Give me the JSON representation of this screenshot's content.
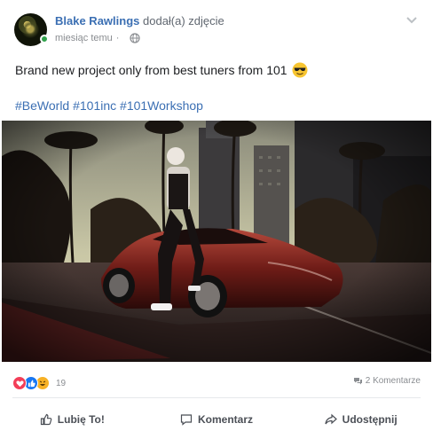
{
  "post": {
    "author_name": "Blake Rawlings",
    "author_action": "dodał(a) zdjęcie",
    "timestamp": "miesiąc temu",
    "separator": "·",
    "privacy_icon": "globe-icon",
    "menu_icon": "chevron-down-icon",
    "text": "Brand new project only from best tuners from 101",
    "text_emoji": "sunglasses-emoji-icon",
    "hashtags": "#BeWorld #101inc #101Workshop",
    "photo_icon": "photo-image"
  },
  "stats": {
    "reaction_icons": [
      "love-reaction-icon",
      "like-reaction-icon",
      "haha-reaction-icon"
    ],
    "reaction_count": "19",
    "comments_label": "2 Komentarze"
  },
  "actions": {
    "like_label": "Lubię To!",
    "comment_label": "Komentarz",
    "share_label": "Udostępnij"
  },
  "colors": {
    "link": "#3b6fb3",
    "online": "#31a24c",
    "love": "#f33e58",
    "like": "#1877f2",
    "haha": "#f7b125"
  }
}
